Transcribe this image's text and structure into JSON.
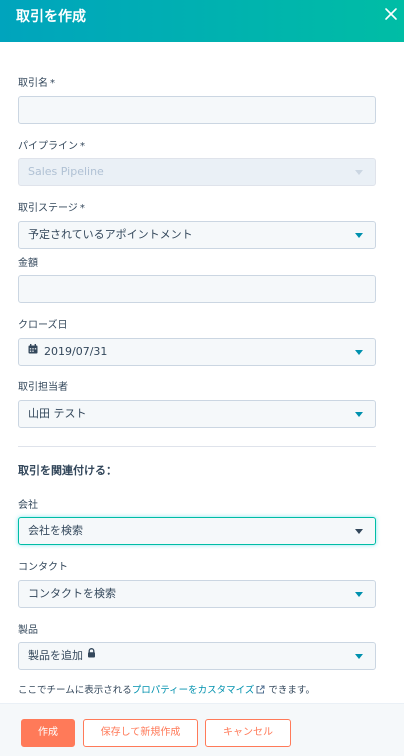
{
  "header": {
    "title": "取引を作成"
  },
  "fields": {
    "deal_name": {
      "label": "取引名",
      "required_mark": "*",
      "value": ""
    },
    "pipeline": {
      "label": "パイプライン",
      "required_mark": "*",
      "value": "Sales Pipeline"
    },
    "deal_stage": {
      "label": "取引ステージ",
      "required_mark": "*",
      "value": "予定されているアポイントメント"
    },
    "amount": {
      "label": "金額",
      "value": ""
    },
    "close_date": {
      "label": "クローズ日",
      "value": "2019/07/31"
    },
    "deal_owner": {
      "label": "取引担当者",
      "value": "山田 テスト"
    }
  },
  "associate": {
    "title": "取引を関連付ける：",
    "company": {
      "label": "会社",
      "value": "会社を検索"
    },
    "contact": {
      "label": "コンタクト",
      "value": "コンタクトを検索"
    },
    "product": {
      "label": "製品",
      "value": "製品を追加"
    }
  },
  "footnote": {
    "prefix": "ここでチームに表示される",
    "link": "プロパティーをカスタマイズ",
    "suffix": " できます。"
  },
  "footer": {
    "create_label": "作成",
    "save_new_label": "保存して新規作成",
    "cancel_label": "キャンセル"
  },
  "colors": {
    "header_start": "#00a4bd",
    "header_end": "#00bda5",
    "accent": "#ff7a59",
    "link": "#0091ae"
  },
  "icons": [
    "close-icon",
    "calendar-icon",
    "lock-icon",
    "external-link-icon",
    "caret-down-icon"
  ]
}
